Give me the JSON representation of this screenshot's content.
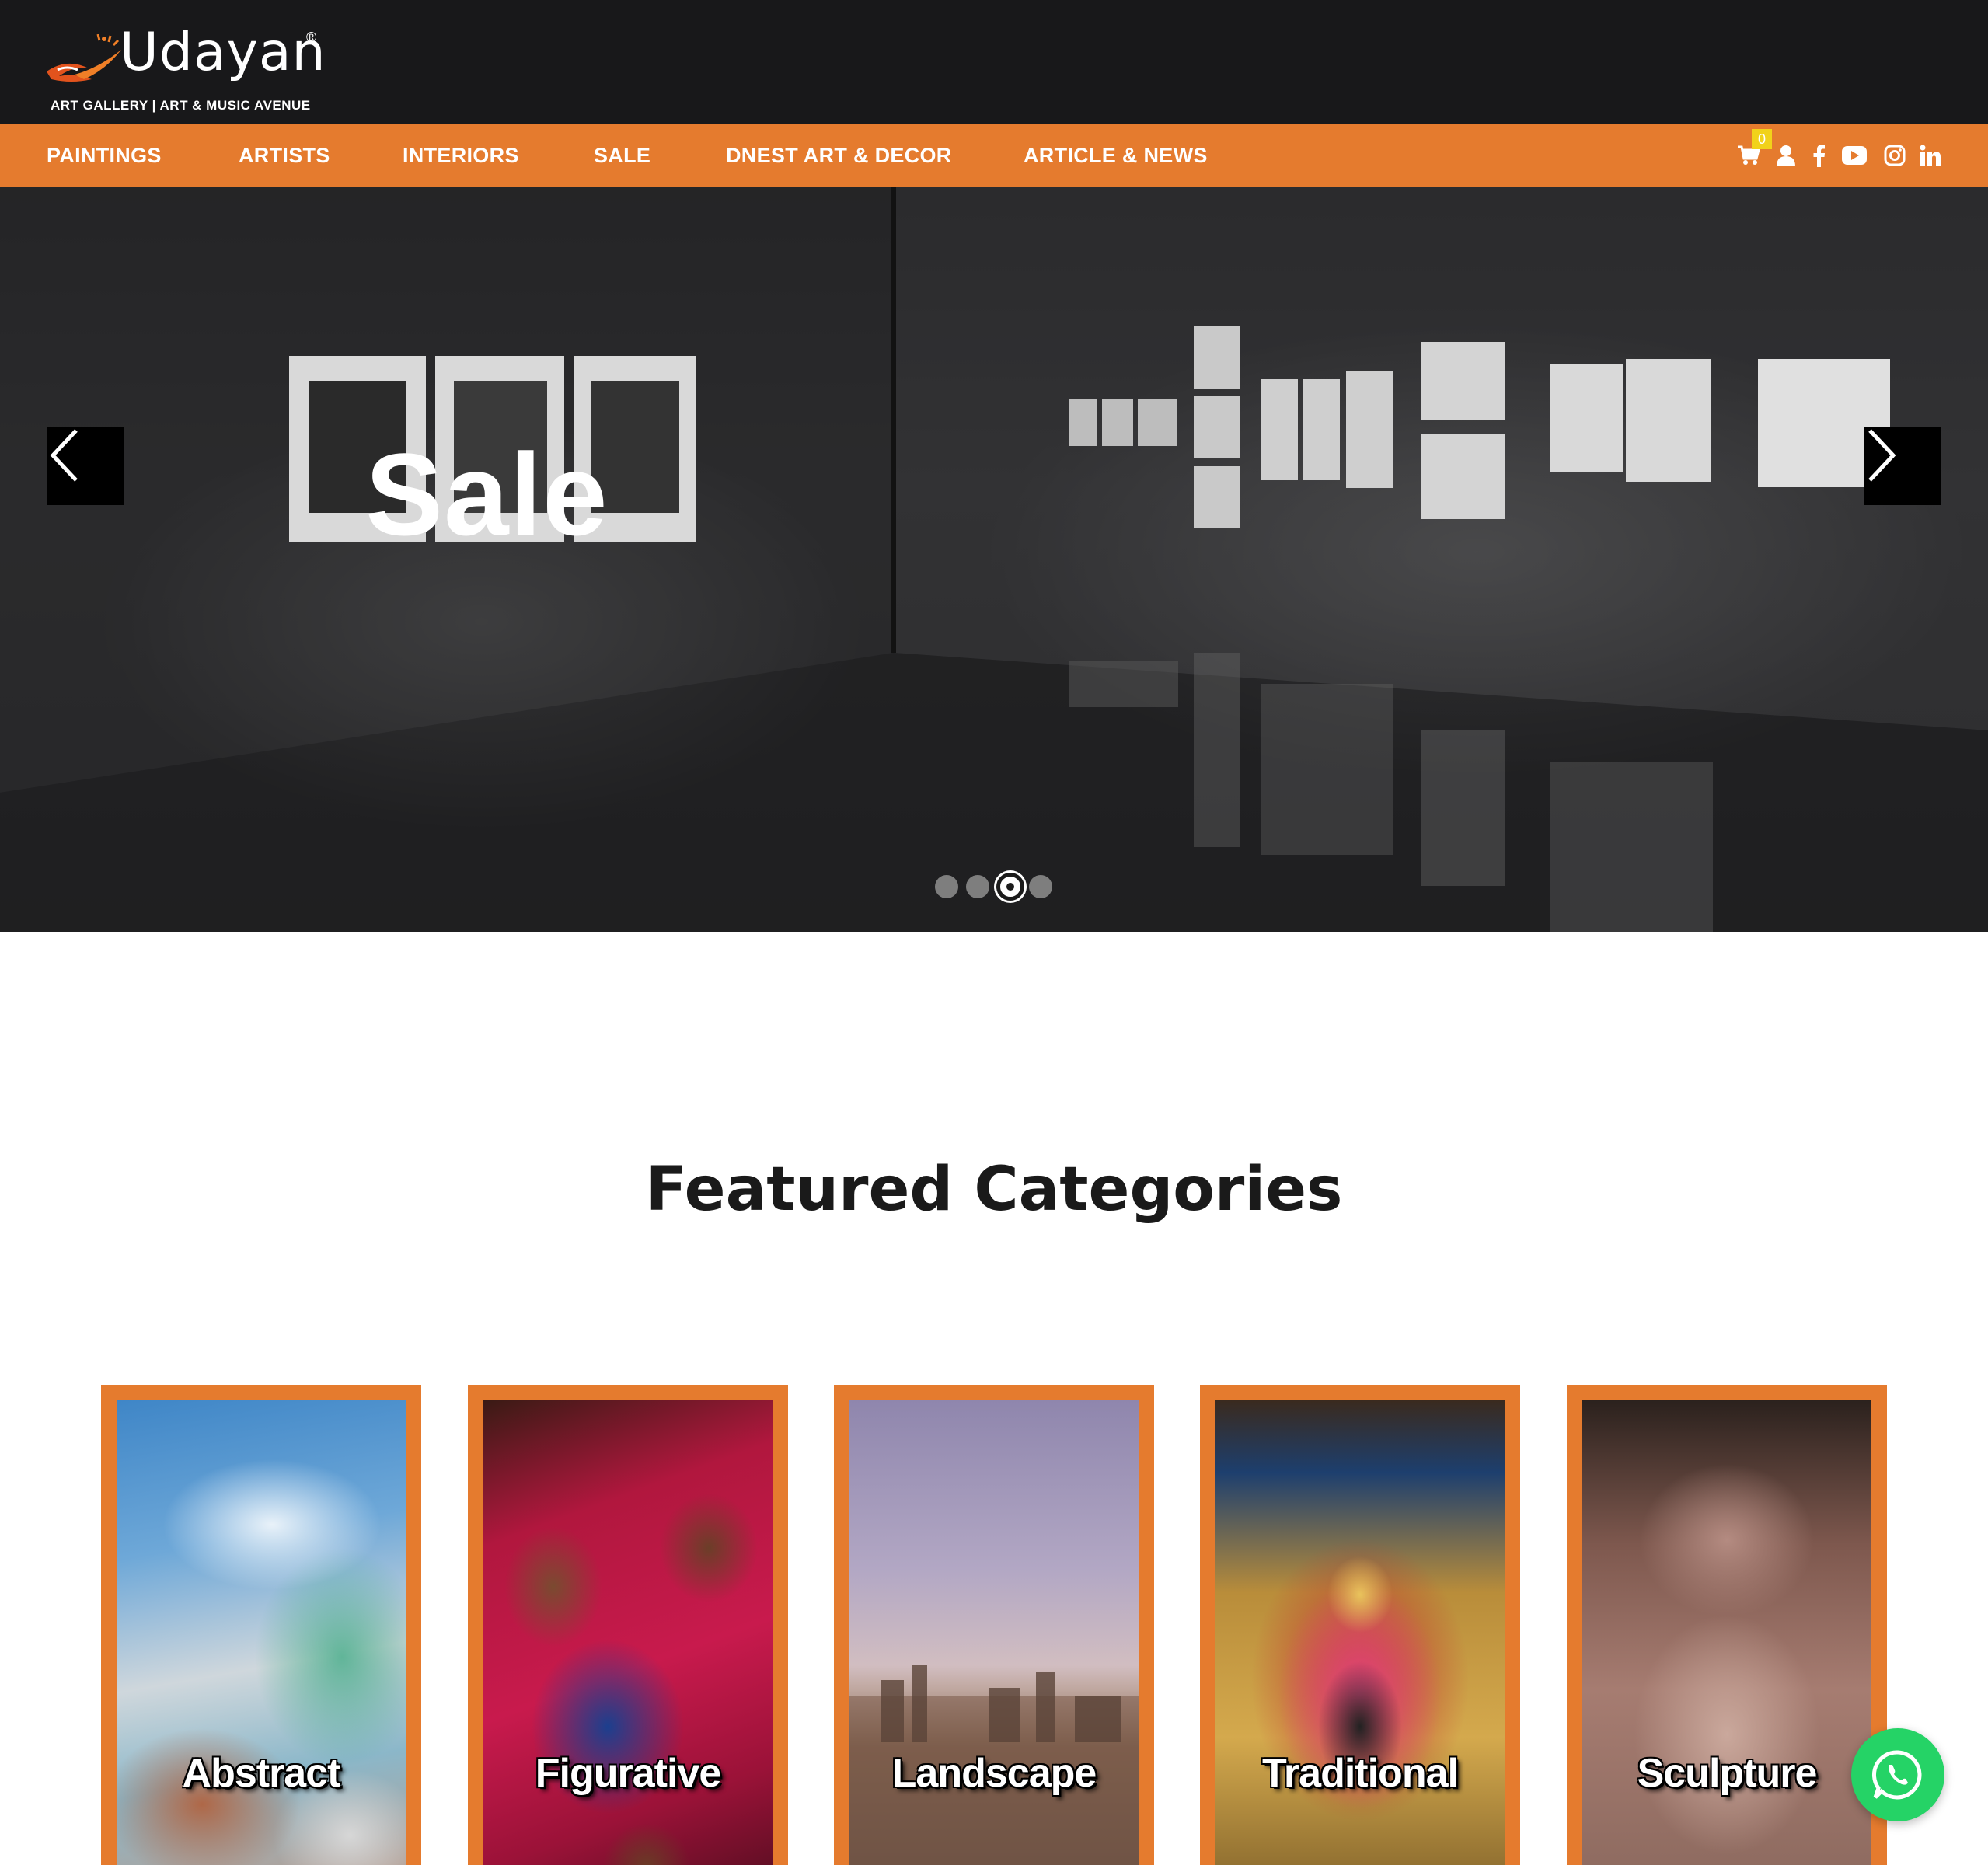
{
  "logo": {
    "name": "Udayan",
    "registered": "®",
    "tagline": "ART GALLERY  |  ART & MUSIC AVENUE"
  },
  "nav": {
    "items": [
      {
        "label": "PAINTINGS"
      },
      {
        "label": "ARTISTS"
      },
      {
        "label": "INTERIORS"
      },
      {
        "label": "SALE"
      },
      {
        "label": "DNEST ART & DECOR"
      },
      {
        "label": "ARTICLE & NEWS"
      }
    ],
    "cart_count": "0",
    "icons": [
      "cart-icon",
      "user-icon",
      "facebook-icon",
      "youtube-icon",
      "instagram-icon",
      "linkedin-icon"
    ]
  },
  "hero": {
    "title": "Sale",
    "slides_total": 4,
    "active_slide": 3
  },
  "featured": {
    "title": "Featured Categories",
    "categories": [
      {
        "label": "Abstract"
      },
      {
        "label": "Figurative"
      },
      {
        "label": "Landscape"
      },
      {
        "label": "Traditional"
      },
      {
        "label": "Sculpture"
      }
    ]
  },
  "colors": {
    "header_bg": "#18181a",
    "accent": "#e57b2e",
    "cart_badge": "#f1d21a",
    "whatsapp": "#25d366"
  }
}
